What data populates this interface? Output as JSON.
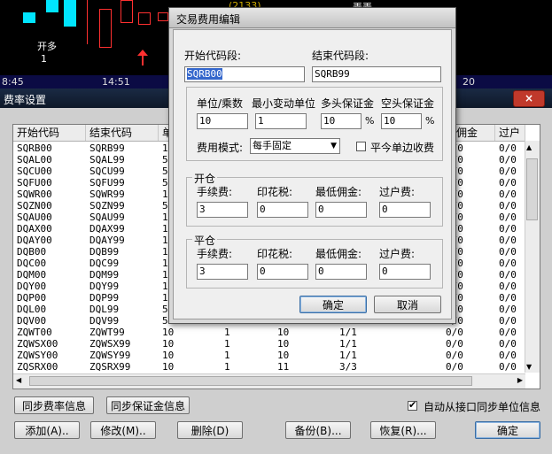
{
  "background_chart": {
    "header_code": "(2133)",
    "header_tag": "弄弄",
    "marker_label": "开多",
    "marker_count": "1",
    "times": [
      "8:45",
      "14:51",
      "20"
    ]
  },
  "fee_window": {
    "title": "费率设置",
    "close_label": "×",
    "columns": [
      "开始代码",
      "结束代码",
      "单",
      "",
      "",
      "",
      "",
      "低佣金",
      "过户"
    ],
    "rows": [
      [
        "SQRB00",
        "SQRB99",
        "1",
        "",
        "",
        "",
        "0/0",
        "0/0"
      ],
      [
        "SQAL00",
        "SQAL99",
        "5",
        "",
        "",
        "",
        "0/0",
        "0/0"
      ],
      [
        "SQCU00",
        "SQCU99",
        "5",
        "",
        "",
        "",
        "0/0",
        "0/0"
      ],
      [
        "SQFU00",
        "SQFU99",
        "5",
        "",
        "",
        "",
        "0/0",
        "0/0"
      ],
      [
        "SQWR00",
        "SQWR99",
        "1",
        "",
        "",
        "",
        "0/0",
        "0/0"
      ],
      [
        "SQZN00",
        "SQZN99",
        "5",
        "",
        "",
        "",
        "0/0",
        "0/0"
      ],
      [
        "SQAU00",
        "SQAU99",
        "1",
        "",
        "",
        "",
        "0/0",
        "0/0"
      ],
      [
        "DQAX00",
        "DQAX99",
        "1",
        "",
        "",
        "",
        "0/0",
        "0/0"
      ],
      [
        "DQAY00",
        "DQAY99",
        "1",
        "",
        "",
        "",
        "0/0",
        "0/0"
      ],
      [
        "DQB00",
        "DQB99",
        "1",
        "",
        "",
        "",
        "0/0",
        "0/0"
      ],
      [
        "DQC00",
        "DQC99",
        "1",
        "",
        "",
        "",
        "0/0",
        "0/0"
      ],
      [
        "DQM00",
        "DQM99",
        "1",
        "",
        "",
        "",
        "0/0",
        "0/0"
      ],
      [
        "DQY00",
        "DQY99",
        "1",
        "",
        "",
        "",
        "0/0",
        "0/0"
      ],
      [
        "DQP00",
        "DQP99",
        "1",
        "",
        "",
        "",
        "0/0",
        "0/0"
      ],
      [
        "DQL00",
        "DQL99",
        "5",
        "",
        "",
        "",
        "0/0",
        "0/0"
      ],
      [
        "DQV00",
        "DQV99",
        "5",
        "",
        "",
        "",
        "0/0",
        "0/0"
      ],
      [
        "ZQWT00",
        "ZQWT99",
        "10",
        "1",
        "10",
        "1/1",
        "0/0",
        "0/0"
      ],
      [
        "ZQWSX00",
        "ZQWSX99",
        "10",
        "1",
        "10",
        "1/1",
        "0/0",
        "0/0"
      ],
      [
        "ZQWSY00",
        "ZQWSY99",
        "10",
        "1",
        "10",
        "1/1",
        "0/0",
        "0/0"
      ],
      [
        "ZQSRX00",
        "ZQSRX99",
        "10",
        "1",
        "11",
        "3/3",
        "0/0",
        "0/0"
      ]
    ],
    "sync_fee_button": "同步费率信息",
    "sync_margin_button": "同步保证金信息",
    "auto_sync_label": "自动从接口同步单位信息",
    "auto_sync_checked": true,
    "add_button": "添加(A)..",
    "edit_button": "修改(M)..",
    "delete_button": "删除(D)",
    "backup_button": "备份(B)...",
    "restore_button": "恢复(R)...",
    "ok_button": "确定"
  },
  "edit_dialog": {
    "title": "交易费用编辑",
    "start_code_label": "开始代码段:",
    "start_code_value": "SQRB00",
    "end_code_label": "结束代码段:",
    "end_code_value": "SQRB99",
    "unit_label": "单位/乘数",
    "unit_value": "10",
    "min_tick_label": "最小变动单位",
    "min_tick_value": "1",
    "long_margin_label": "多头保证金",
    "long_margin_value": "10",
    "short_margin_label": "空头保证金",
    "short_margin_value": "10",
    "percent_sign": "%",
    "fee_mode_label": "费用模式:",
    "fee_mode_value": "每手固定",
    "close_today_single_label": "平今单边收费",
    "open_group_label": "开仓",
    "close_group_label": "平仓",
    "fee_label": "手续费:",
    "stamp_label": "印花税:",
    "min_commission_label": "最低佣金:",
    "transfer_label": "过户费:",
    "open_fee_value": "3",
    "open_stamp_value": "0",
    "open_min_value": "0",
    "open_transfer_value": "0",
    "close_fee_value": "3",
    "close_stamp_value": "0",
    "close_min_value": "0",
    "close_transfer_value": "0",
    "ok_button": "确定",
    "cancel_button": "取消"
  }
}
